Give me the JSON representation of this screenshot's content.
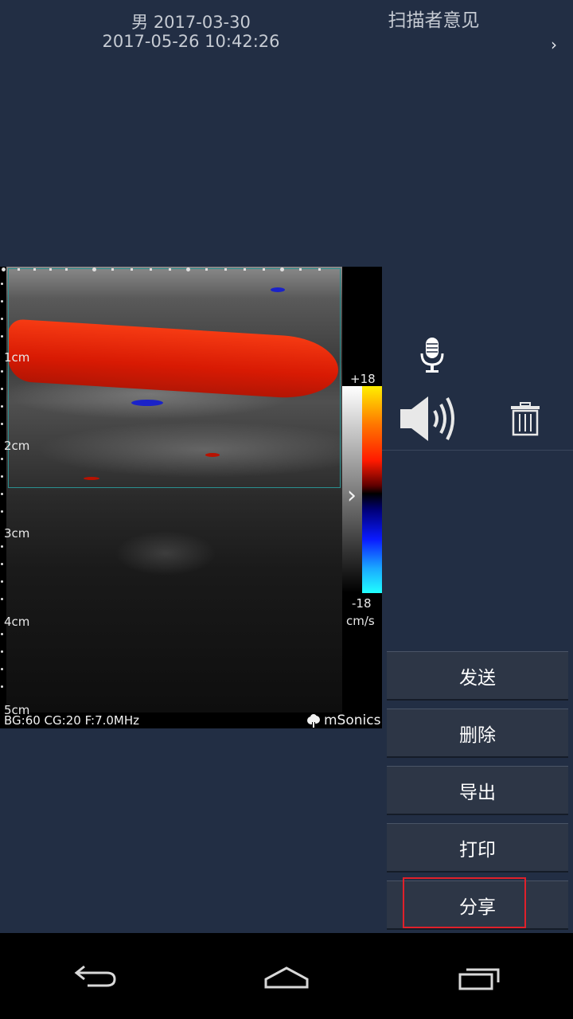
{
  "header": {
    "patient_line": "男 2017-03-30",
    "datetime": "2017-05-26 10:42:26",
    "scanner_opinion": "扫描者意见",
    "next_icon": "chevron-right"
  },
  "ultrasound": {
    "depth_labels": [
      "1cm",
      "2cm",
      "3cm",
      "4cm",
      "5cm"
    ],
    "scale_max": "+18",
    "scale_min": "-18",
    "scale_unit": "cm/s",
    "params": "BG:60 CG:20 F:7.0MHz",
    "brand": "mSonics",
    "flow_color": "#ff2a08",
    "roi_color": "#2a8f8f"
  },
  "tools": {
    "mic_icon": "microphone",
    "speaker_icon": "speaker",
    "trash_icon": "trash"
  },
  "actions": {
    "send": "发送",
    "delete": "删除",
    "export": "导出",
    "print": "打印",
    "share": "分享"
  },
  "highlight_color": "#e0202a",
  "navbar": {
    "back_icon": "back",
    "home_icon": "home",
    "recents_icon": "recents"
  }
}
